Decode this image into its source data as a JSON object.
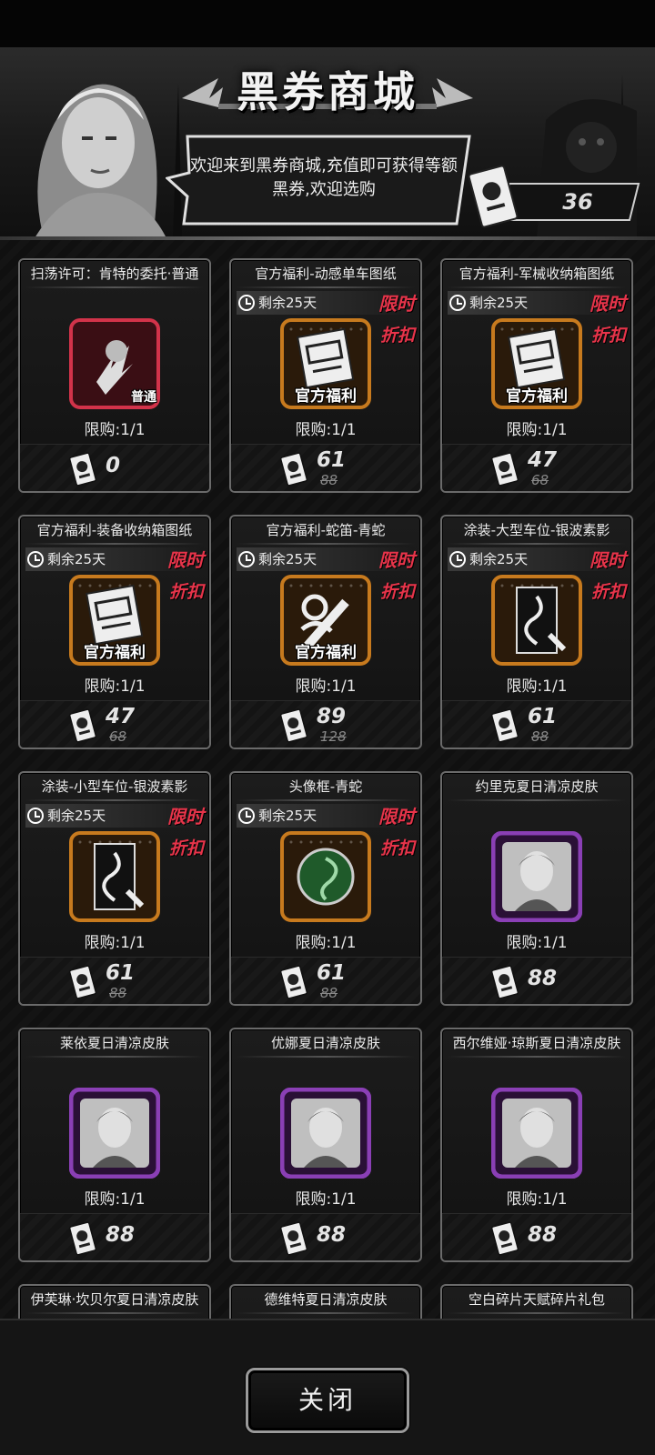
{
  "header": {
    "title": "黑券商城",
    "welcome_text": "欢迎来到黑券商城,充值即可获得等额黑券,欢迎选购",
    "balance": "36"
  },
  "colors": {
    "limited_red": "#e8344a",
    "rare_purple": "#8a3fb5",
    "orange_frame": "#c77a1e"
  },
  "items": [
    {
      "name": "扫荡许可：肯特的委托·普通",
      "timer": "",
      "limited": "",
      "discount": "",
      "badge": "普通",
      "limit": "限购:1/1",
      "price": "0",
      "old_price": "",
      "icon": "sweep-permit-icon"
    },
    {
      "name": "官方福利-动感单车图纸",
      "timer": "剩余25天",
      "limited": "限时",
      "discount": "折扣",
      "badge": "官方福利",
      "limit": "限购:1/1",
      "price": "61",
      "old_price": "88",
      "icon": "bike-blueprint-icon"
    },
    {
      "name": "官方福利-军械收纳箱图纸",
      "timer": "剩余25天",
      "limited": "限时",
      "discount": "折扣",
      "badge": "官方福利",
      "limit": "限购:1/1",
      "price": "47",
      "old_price": "68",
      "icon": "weapon-box-blueprint-icon"
    },
    {
      "name": "官方福利-装备收纳箱图纸",
      "timer": "剩余25天",
      "limited": "限时",
      "discount": "折扣",
      "badge": "官方福利",
      "limit": "限购:1/1",
      "price": "47",
      "old_price": "68",
      "icon": "gear-box-blueprint-icon"
    },
    {
      "name": "官方福利-蛇笛-青蛇",
      "timer": "剩余25天",
      "limited": "限时",
      "discount": "折扣",
      "badge": "官方福利",
      "limit": "限购:1/1",
      "price": "89",
      "old_price": "128",
      "icon": "snake-flute-icon"
    },
    {
      "name": "涂装-大型车位-银波素影",
      "timer": "剩余25天",
      "limited": "限时",
      "discount": "折扣",
      "badge": "",
      "limit": "限购:1/1",
      "price": "61",
      "old_price": "88",
      "icon": "paint-large-slot-icon"
    },
    {
      "name": "涂装-小型车位-银波素影",
      "timer": "剩余25天",
      "limited": "限时",
      "discount": "折扣",
      "badge": "",
      "limit": "限购:1/1",
      "price": "61",
      "old_price": "88",
      "icon": "paint-small-slot-icon"
    },
    {
      "name": "头像框-青蛇",
      "timer": "剩余25天",
      "limited": "限时",
      "discount": "折扣",
      "badge": "",
      "limit": "限购:1/1",
      "price": "61",
      "old_price": "88",
      "icon": "snake-avatar-frame-icon"
    },
    {
      "name": "约里克夏日清凉皮肤",
      "timer": "",
      "limited": "",
      "discount": "",
      "badge": "",
      "limit": "限购:1/1",
      "price": "88",
      "old_price": "",
      "icon": "yorick-skin-portrait"
    },
    {
      "name": "莱依夏日清凉皮肤",
      "timer": "",
      "limited": "",
      "discount": "",
      "badge": "",
      "limit": "限购:1/1",
      "price": "88",
      "old_price": "",
      "icon": "lai-skin-portrait"
    },
    {
      "name": "优娜夏日清凉皮肤",
      "timer": "",
      "limited": "",
      "discount": "",
      "badge": "",
      "limit": "限购:1/1",
      "price": "88",
      "old_price": "",
      "icon": "yuna-skin-portrait"
    },
    {
      "name": "西尔维娅·琼斯夏日清凉皮肤",
      "timer": "",
      "limited": "",
      "discount": "",
      "badge": "",
      "limit": "限购:1/1",
      "price": "88",
      "old_price": "",
      "icon": "sylvia-skin-portrait"
    },
    {
      "name": "伊芙琳·坎贝尔夏日清凉皮肤",
      "timer": "",
      "limited": "",
      "discount": "",
      "badge": "",
      "limit": "",
      "price": "",
      "old_price": "",
      "icon": "evelyn-skin-portrait"
    },
    {
      "name": "德维特夏日清凉皮肤",
      "timer": "",
      "limited": "",
      "discount": "",
      "badge": "",
      "limit": "",
      "price": "",
      "old_price": "",
      "icon": "dewitt-skin-portrait"
    },
    {
      "name": "空白碎片天赋碎片礼包",
      "timer": "",
      "limited": "",
      "discount": "",
      "badge": "",
      "limit": "",
      "price": "",
      "old_price": "",
      "icon": "talent-fragment-pack-icon"
    }
  ],
  "footer": {
    "close_label": "关闭"
  }
}
